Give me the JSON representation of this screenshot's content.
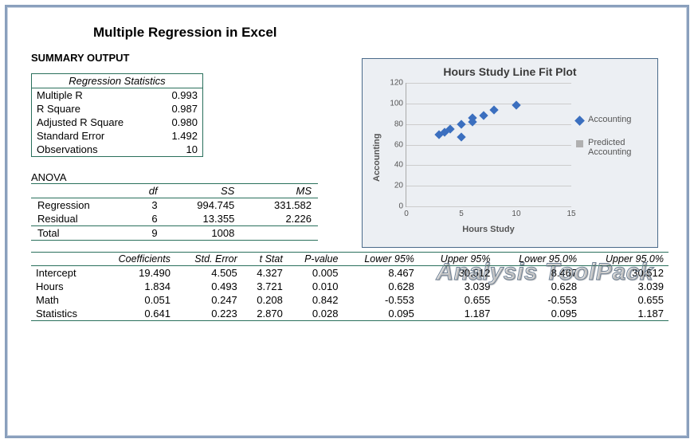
{
  "title": "Multiple Regression in Excel",
  "summary_label": "SUMMARY OUTPUT",
  "reg_stats": {
    "header": "Regression Statistics",
    "rows": [
      {
        "label": "Multiple R",
        "value": "0.993"
      },
      {
        "label": "R Square",
        "value": "0.987"
      },
      {
        "label": "Adjusted R Square",
        "value": "0.980"
      },
      {
        "label": "Standard Error",
        "value": "1.492"
      },
      {
        "label": "Observations",
        "value": "10"
      }
    ]
  },
  "anova": {
    "label": "ANOVA",
    "headers": [
      "",
      "df",
      "SS",
      "MS"
    ],
    "rows": [
      {
        "label": "Regression",
        "df": "3",
        "ss": "994.745",
        "ms": "331.582"
      },
      {
        "label": "Residual",
        "df": "6",
        "ss": "13.355",
        "ms": "2.226"
      },
      {
        "label": "Total",
        "df": "9",
        "ss": "1008",
        "ms": ""
      }
    ]
  },
  "coef": {
    "headers": [
      "",
      "Coefficients",
      "Std. Error",
      "t Stat",
      "P-value",
      "Lower 95%",
      "Upper 95%",
      "Lower 95.0%",
      "Upper 95.0%"
    ],
    "rows": [
      {
        "label": "Intercept",
        "c": "19.490",
        "se": "4.505",
        "t": "4.327",
        "p": "0.005",
        "l95": "8.467",
        "u95": "30.512",
        "l950": "8.467",
        "u950": "30.512"
      },
      {
        "label": "Hours",
        "c": "1.834",
        "se": "0.493",
        "t": "3.721",
        "p": "0.010",
        "l95": "0.628",
        "u95": "3.039",
        "l950": "0.628",
        "u950": "3.039"
      },
      {
        "label": "Math",
        "c": "0.051",
        "se": "0.247",
        "t": "0.208",
        "p": "0.842",
        "l95": "-0.553",
        "u95": "0.655",
        "l950": "-0.553",
        "u950": "0.655"
      },
      {
        "label": "Statistics",
        "c": "0.641",
        "se": "0.223",
        "t": "2.870",
        "p": "0.028",
        "l95": "0.095",
        "u95": "1.187",
        "l950": "0.095",
        "u950": "1.187"
      }
    ]
  },
  "chart": {
    "title": "Hours Study Line Fit  Plot",
    "ylabel": "Accounting",
    "xlabel": "Hours Study",
    "legend": [
      {
        "name": "Accounting",
        "marker": "blue"
      },
      {
        "name": "Predicted Accounting",
        "marker": "gray"
      }
    ],
    "yticks": [
      0,
      20,
      40,
      60,
      80,
      100,
      120
    ],
    "xticks": [
      0,
      5,
      10,
      15
    ]
  },
  "chart_data": {
    "type": "scatter",
    "title": "Hours Study Line Fit  Plot",
    "xlabel": "Hours Study",
    "ylabel": "Accounting",
    "xlim": [
      0,
      15
    ],
    "ylim": [
      0,
      120
    ],
    "series": [
      {
        "name": "Accounting",
        "x": [
          3,
          3.5,
          4,
          5,
          5,
          6,
          6,
          7,
          8,
          10
        ],
        "y": [
          70,
          72,
          75,
          67,
          80,
          82,
          86,
          88,
          94,
          98
        ]
      },
      {
        "name": "Predicted Accounting",
        "x": [],
        "y": []
      }
    ]
  },
  "toolpack": "Analysis ToolPack"
}
